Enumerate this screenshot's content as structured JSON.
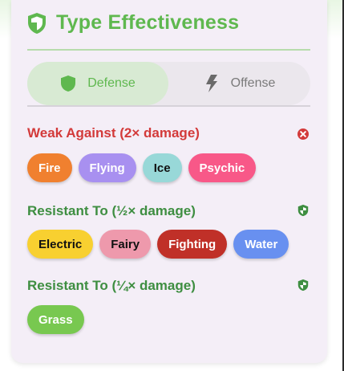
{
  "header": {
    "title": "Type Effectiveness",
    "accent_color": "#5fb84f",
    "icon": "shield-icon"
  },
  "tabs": [
    {
      "label": "Defense",
      "icon": "shield-icon",
      "selected": true
    },
    {
      "label": "Offense",
      "icon": "lightning-icon",
      "selected": false
    }
  ],
  "sections": [
    {
      "title": "Weak Against (2× damage)",
      "title_color": "#d33a3a",
      "icon": "x-circle-icon",
      "chips": [
        {
          "label": "Fire",
          "color": "#f0802f",
          "text_color": "#ffffff"
        },
        {
          "label": "Flying",
          "color": "#a890f0",
          "text_color": "#ffffff"
        },
        {
          "label": "Ice",
          "color": "#98d8d8",
          "text_color": "#111111"
        },
        {
          "label": "Psychic",
          "color": "#f85888",
          "text_color": "#ffffff"
        }
      ]
    },
    {
      "title": "Resistant To (½× damage)",
      "title_color": "#3e8e41",
      "icon": "shield-icon",
      "chips": [
        {
          "label": "Electric",
          "color": "#f8d030",
          "text_color": "#111111"
        },
        {
          "label": "Fairy",
          "color": "#ee99ac",
          "text_color": "#111111"
        },
        {
          "label": "Fighting",
          "color": "#c03028",
          "text_color": "#ffffff"
        },
        {
          "label": "Water",
          "color": "#6890f0",
          "text_color": "#ffffff"
        }
      ]
    },
    {
      "title": "Resistant To (¼× damage)",
      "title_color": "#3e8e41",
      "icon": "shield-icon",
      "chips": [
        {
          "label": "Grass",
          "color": "#78c850",
          "text_color": "#ffffff"
        }
      ]
    }
  ]
}
